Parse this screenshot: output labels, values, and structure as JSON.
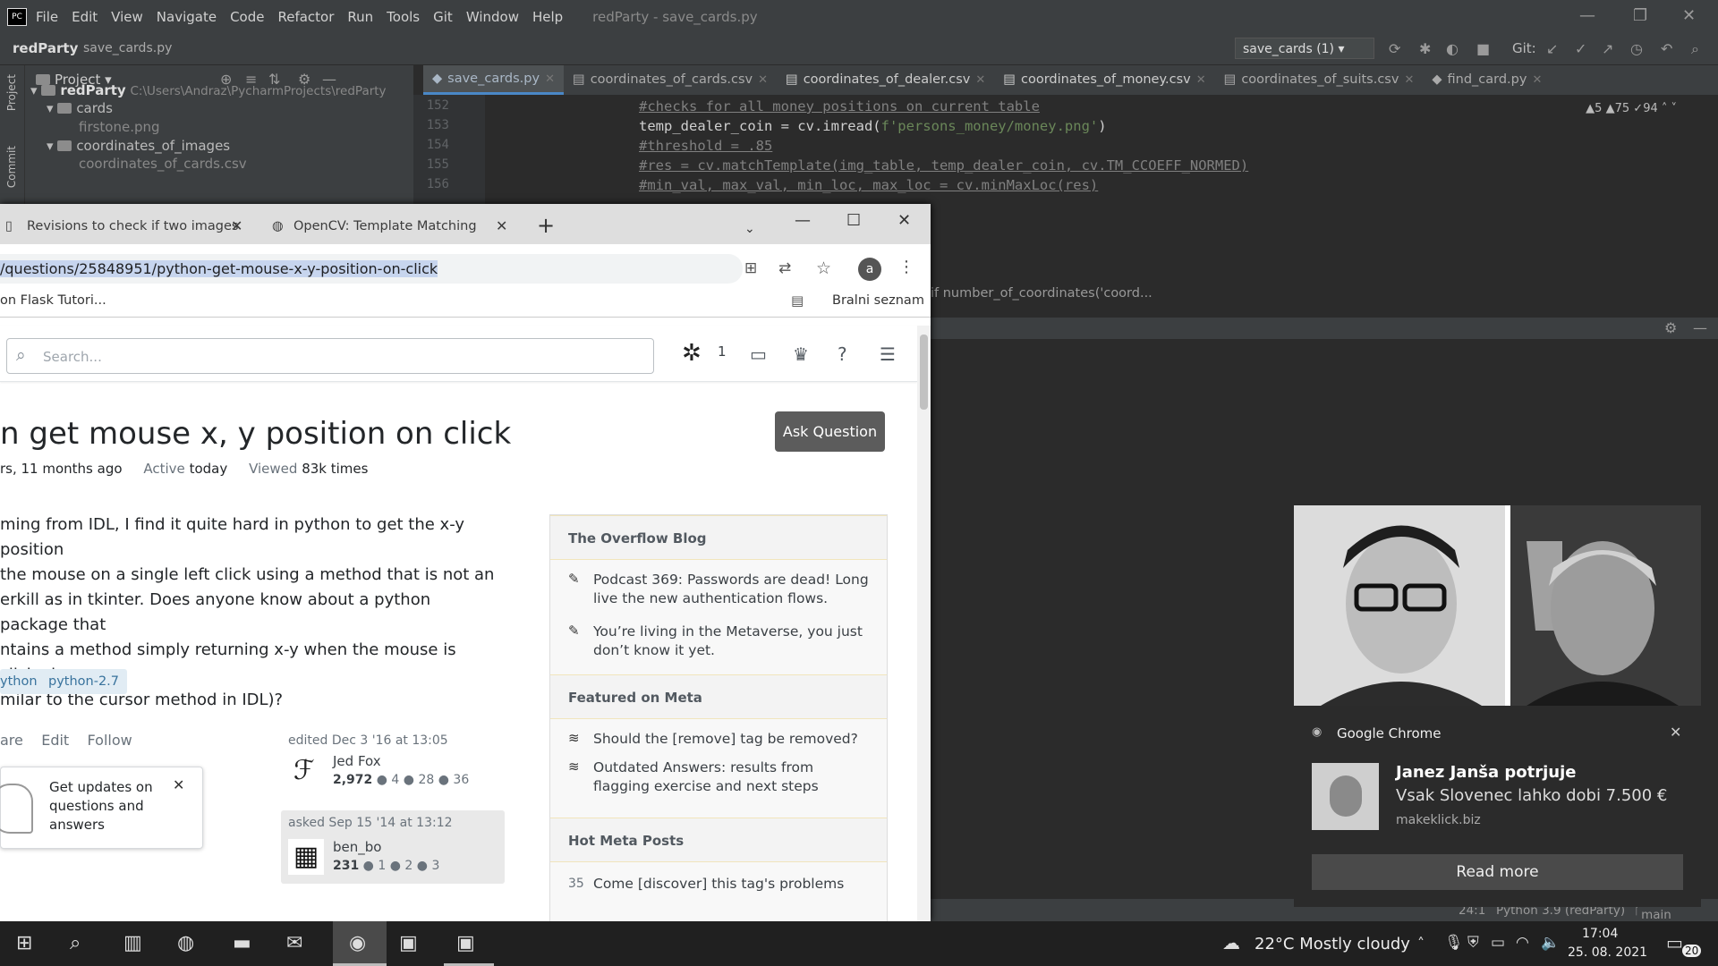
{
  "ide": {
    "menu": [
      "File",
      "Edit",
      "View",
      "Navigate",
      "Code",
      "Refactor",
      "Run",
      "Tools",
      "Git",
      "Window",
      "Help"
    ],
    "window_title": "redParty - save_cards.py",
    "breadcrumb_project": "redParty",
    "breadcrumb_file": "save_cards.py",
    "run_config": "save_cards (1)",
    "git_label": "Git:",
    "tabs": [
      "save_cards.py",
      "coordinates_of_cards.csv",
      "coordinates_of_dealer.csv",
      "coordinates_of_money.csv",
      "coordinates_of_suits.csv",
      "find_card.py"
    ],
    "project_label": "Project",
    "side_labels": [
      "Project",
      "Commit"
    ],
    "tree": {
      "root": "redParty",
      "root_path": "C:\\Users\\Andraz\\PycharmProjects\\redParty",
      "cards": "cards",
      "firstone": "firstone.png",
      "coords_folder": "coordinates_of_images",
      "coords_file": "coordinates_of_cards.csv"
    },
    "line_numbers": [
      "152",
      "153",
      "154",
      "155",
      "156"
    ],
    "code": {
      "l152": "#checks for all money positions on current table",
      "l153_a": "temp_dealer_coin = cv.imread(",
      "l153_str": "f'persons_money/money.png'",
      "l153_b": ")",
      "l154": "#threshold = .85",
      "l155": "#res = cv.matchTemplate(img_table, temp_dealer_coin, cv.TM_CCOEFF_NORMED)",
      "l156": "#min_val, max_val, min_loc, max_loc = cv.minMaxLoc(res)"
    },
    "inspections": {
      "warn1": "5",
      "warn2": "75",
      "ok": "94"
    },
    "structure_line": "if number_of_coordinates('coord...",
    "status": {
      "pos": "24:1",
      "interpreter": "Python 3.9 (redParty)",
      "branch": "main"
    }
  },
  "chrome": {
    "tab1": "Revisions to check if two images",
    "tab2": "OpenCV: Template Matching",
    "url": "/questions/25848951/python-get-mouse-x-y-position-on-click",
    "avatar": "a",
    "bookmark": "on Flask Tutori...",
    "reading_list": "Bralni seznam"
  },
  "so": {
    "search_placeholder": "Search...",
    "inbox_count": "1",
    "title": "n get mouse x, y position on click",
    "ask_button": "Ask Question",
    "asked": "rs, 11 months ago",
    "active_label": "Active",
    "active_value": "today",
    "viewed_label": "Viewed",
    "viewed_value": "83k times",
    "body": [
      "ming from IDL, I find it quite hard in python to get the x-y position",
      "the mouse on a single left click using a method that is not an",
      "erkill as in tkinter. Does anyone know about a python package that",
      "ntains a method simply returning x-y when the mouse is clicked",
      "milar to the cursor method in IDL)?"
    ],
    "tags": [
      "ython",
      "python-2.7"
    ],
    "actions": {
      "share": "are",
      "edit": "Edit",
      "follow": "Follow"
    },
    "edited": {
      "label": "edited Dec 3 '16 at 13:05",
      "name": "Jed Fox",
      "rep": "2,972",
      "gold": "4",
      "silver": "28",
      "bronze": "36"
    },
    "asked_card": {
      "label": "asked Sep 15 '14 at 13:12",
      "name": "ben_bo",
      "rep": "231",
      "gold": "1",
      "silver": "2",
      "bronze": "3"
    },
    "toast": "Get updates on questions and answers",
    "sidebar": {
      "blog_header": "The Overflow Blog",
      "blog1": "Podcast 369: Passwords are dead! Long live the new authentication flows.",
      "blog2": "You’re living in the Metaverse, you just don’t know it yet.",
      "meta_header": "Featured on Meta",
      "meta1": "Should the [remove] tag be removed?",
      "meta2": "Outdated Answers: results from flagging exercise and next steps",
      "hot_header": "Hot Meta Posts",
      "hot1_count": "35",
      "hot1": "Come [discover] this tag's problems"
    }
  },
  "notification": {
    "app": "Google Chrome",
    "title": "Janez Janša potrjuje",
    "body": "Vsak Slovenec lahko dobi 7.500 €",
    "source": "makeklick.biz",
    "button": "Read more"
  },
  "taskbar": {
    "weather": "22°C  Mostly cloudy",
    "time": "17:04",
    "date": "25. 08. 2021",
    "notif_count": "20"
  }
}
